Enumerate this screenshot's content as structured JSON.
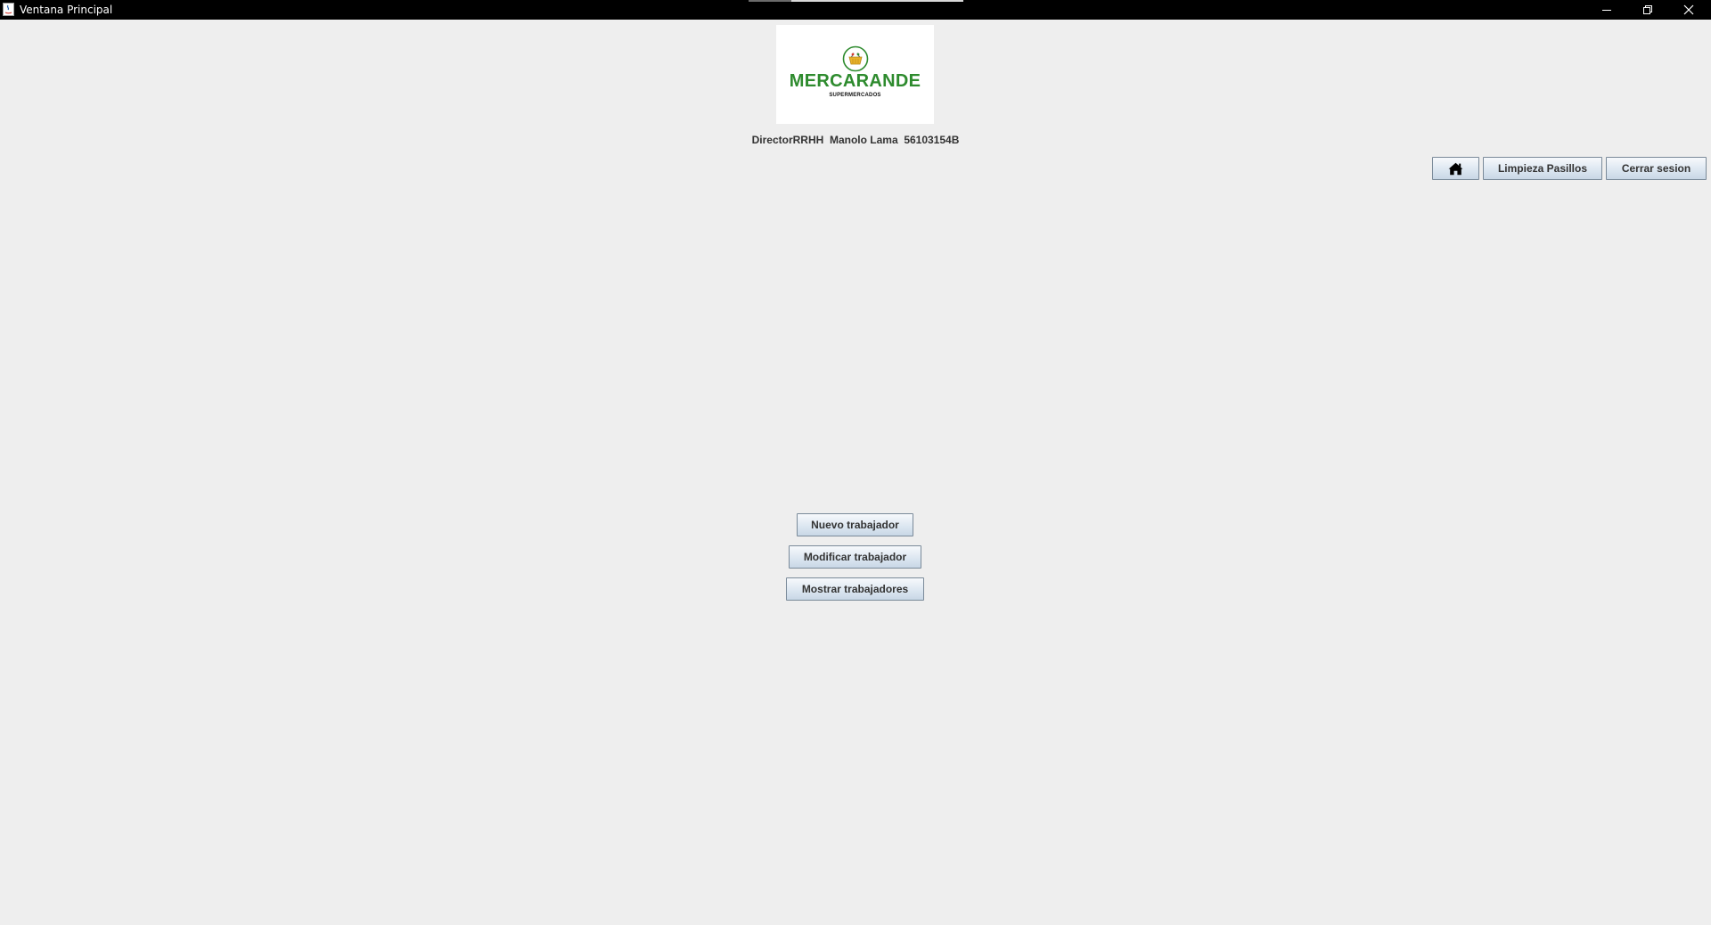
{
  "window": {
    "title": "Ventana Principal",
    "controls": {
      "minimize_icon": "minimize-icon",
      "maximize_icon": "restore-icon",
      "close_icon": "close-icon"
    }
  },
  "logo": {
    "brand": "MERCARANDE",
    "tagline": "SUPERMERCADOS",
    "brand_color": "#2e8b2e",
    "accent_color": "#e8b22a"
  },
  "user": {
    "info": "DirectorRRHH  Manolo Lama  56103154B"
  },
  "top_actions": {
    "home_icon": "home-icon",
    "limpieza_label": "Limpieza Pasillos",
    "cerrar_label": "Cerrar sesion"
  },
  "main_actions": {
    "nuevo_label": "Nuevo trabajador",
    "modificar_label": "Modificar trabajador",
    "mostrar_label": "Mostrar trabajadores"
  },
  "colors": {
    "background": "#eeeeee",
    "titlebar": "#000000",
    "button_border": "#7a8a99"
  }
}
